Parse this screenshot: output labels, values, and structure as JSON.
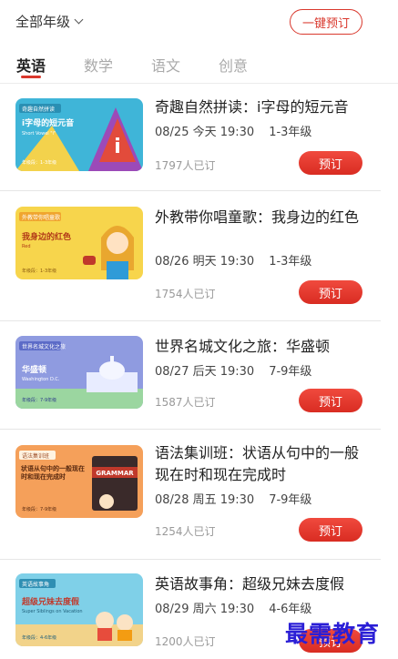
{
  "header": {
    "grade_filter": "全部年级",
    "one_click_reserve": "一键预订"
  },
  "tabs": [
    {
      "label": "英语",
      "active": true
    },
    {
      "label": "数学",
      "active": false
    },
    {
      "label": "语文",
      "active": false
    },
    {
      "label": "创意",
      "active": false
    }
  ],
  "courses": [
    {
      "title": "奇趣自然拼读：i字母的短元音",
      "date": "08/25 今天 19:30",
      "grades": "1-3年级",
      "subscribers": "1797人已订",
      "button": "预订",
      "thumb": {
        "series": "奇趣自然拼读",
        "headline": "i字母的短元音",
        "subline": "Short Vowel \"i\"",
        "grade": "年级段：1-3年级",
        "bg": "#3fb5d8"
      }
    },
    {
      "title": "外教带你唱童歌：我身边的红色",
      "date": "08/26 明天 19:30",
      "grades": "1-3年级",
      "subscribers": "1754人已订",
      "button": "预订",
      "thumb": {
        "series": "外教带你唱童歌",
        "headline": "我身边的红色",
        "subline": "Red",
        "grade": "年级段：1-3年级",
        "bg": "#f7d54c"
      }
    },
    {
      "title": "世界名城文化之旅：华盛顿",
      "date": "08/27 后天 19:30",
      "grades": "7-9年级",
      "subscribers": "1587人已订",
      "button": "预订",
      "thumb": {
        "series": "世界名城文化之旅",
        "headline": "华盛顿",
        "subline": "Washington D.C.",
        "grade": "年级段：7-9年级",
        "bg": "#8f9be0"
      }
    },
    {
      "title": "语法集训班：状语从句中的一般现在时和现在完成时",
      "date": "08/28 周五 19:30",
      "grades": "7-9年级",
      "subscribers": "1254人已订",
      "button": "预订",
      "thumb": {
        "series": "语法集训班",
        "headline": "状语从句中的一般现在时和现在完成时",
        "subline": "GRAMMAR",
        "grade": "年级段：7-9年级",
        "bg": "#f5a05a"
      }
    },
    {
      "title": "英语故事角：超级兄妹去度假",
      "date": "08/29 周六 19:30",
      "grades": "4-6年级",
      "subscribers": "1200人已订",
      "button": "预订",
      "thumb": {
        "series": "英语故事角",
        "headline": "超级兄妹去度假",
        "subline": "Super Siblings on Vacation",
        "grade": "年级段：4-6年级",
        "bg": "#7fd0e8"
      }
    }
  ],
  "watermark": "最需教育",
  "colors": {
    "accent": "#d9382d",
    "tab_inactive": "#aaaaaa",
    "count_gray": "#999999"
  }
}
